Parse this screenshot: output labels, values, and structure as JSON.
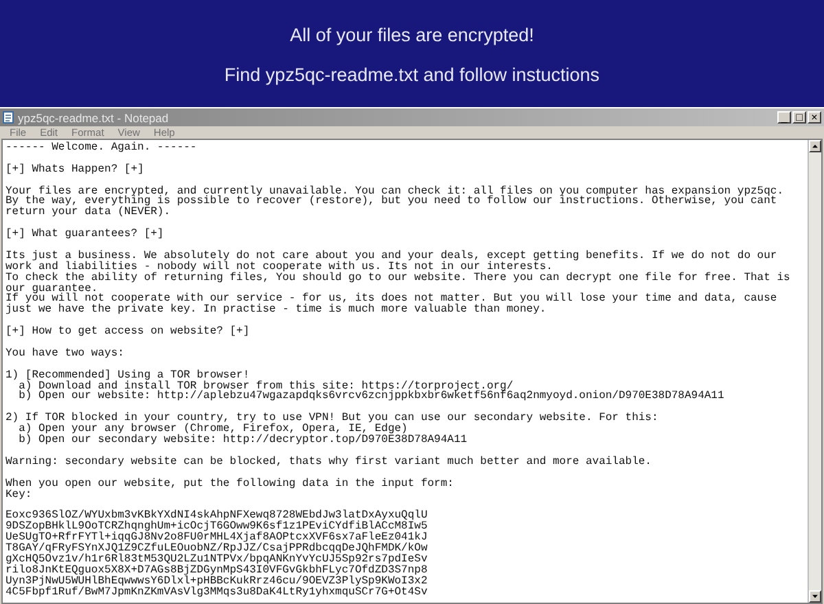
{
  "desktop": {
    "messages": [
      "All of your files are encrypted!",
      "Find ypz5qc-readme.txt and follow instuctions"
    ]
  },
  "window": {
    "title": "ypz5qc-readme.txt - Notepad",
    "controls": [
      "_",
      "□",
      "×"
    ]
  },
  "menu": [
    "File",
    "Edit",
    "Format",
    "View",
    "Help"
  ],
  "document": {
    "paragraphs": [
      {
        "lines": [
          "------ Welcome. Again. ------"
        ]
      },
      {
        "lines": [
          "[+] Whats Happen? [+]"
        ]
      },
      {
        "lines": [
          "Your files are encrypted, and currently unavailable. You can check it: all files on you computer has expansion ypz5qc.",
          "By the way, everything is possible to recover (restore), but you need to follow our instructions. Otherwise, you cant",
          "return your data (NEVER)."
        ]
      },
      {
        "lines": [
          "[+] What guarantees? [+]"
        ]
      },
      {
        "lines": [
          "Its just a business. We absolutely do not care about you and your deals, except getting benefits. If we do not do our",
          "work and liabilities - nobody will not cooperate with us. Its not in our interests.",
          "To check the ability of returning files, You should go to our website. There you can decrypt one file for free. That is",
          "our guarantee.",
          "If you will not cooperate with our service - for us, its does not matter. But you will lose your time and data, cause",
          "just we have the private key. In practise - time is much more valuable than money."
        ]
      },
      {
        "lines": [
          "[+] How to get access on website? [+]"
        ]
      },
      {
        "lines": [
          "You have two ways:"
        ]
      },
      {
        "lines": [
          "1) [Recommended] Using a TOR browser!",
          "  a) Download and install TOR browser from this site: https://torproject.org/",
          "  b) Open our website: http://aplebzu47wgazapdqks6vrcv6zcnjppkbxbr6wketf56nf6aq2nmyoyd.onion/D970E38D78A94A11"
        ]
      },
      {
        "lines": [
          "2) If TOR blocked in your country, try to use VPN! But you can use our secondary website. For this:",
          "  a) Open your any browser (Chrome, Firefox, Opera, IE, Edge)",
          "  b) Open our secondary website: http://decryptor.top/D970E38D78A94A11"
        ]
      },
      {
        "lines": [
          "Warning: secondary website can be blocked, thats why first variant much better and more available."
        ]
      },
      {
        "lines": [
          "When you open our website, put the following data in the input form:",
          "Key:"
        ]
      },
      {
        "lines": [
          "Eoxc936SlOZ/WYUxbm3vKBkYXdNI4skAhpNFXewq8728WEbdJw3latDxAyxuQqlU",
          "9DSZopBHklL9OoTCRZhqnghUm+icOcjT6GOww9K6sf1z1PEviCYdfiBlACcM8Iw5",
          "UeSUgTO+RfrFYTl+iqqGJ8Nv2o8FU0rMHL4Xjaf8AOPtcxXVF6sx7aFleEz041kJ",
          "T8GAY/qFRyFSYnXJQ1Z9CZfuLEOuobNZ/RpJJZ/CsajPPRdbcqqDeJQhFMDK/kOw",
          "gXcHQ5Ovz1v/h1r6Rl83tM53QU2LZu1NTPVx/bpqANKnYvYcUJ5Sp92rs7pdIeSv",
          "rilo8JnKtEQguox5X8X+D7AGs8BjZDGynMpS43I0VFGvGkbhFLyc7OfdZD3S7np8",
          "Uyn3PjNwU5WUHlBhEqwwwsY6Dlxl+pHBBcKukRrz46cu/9OEVZ3PlySp9KWoI3x2",
          "4C5Fbpf1Ruf/BwM7JpmKnZKmVAsVlg3MMqs3u8DaK4LtRy1yhxmquSCr7G+Ot4Sv"
        ]
      }
    ]
  }
}
